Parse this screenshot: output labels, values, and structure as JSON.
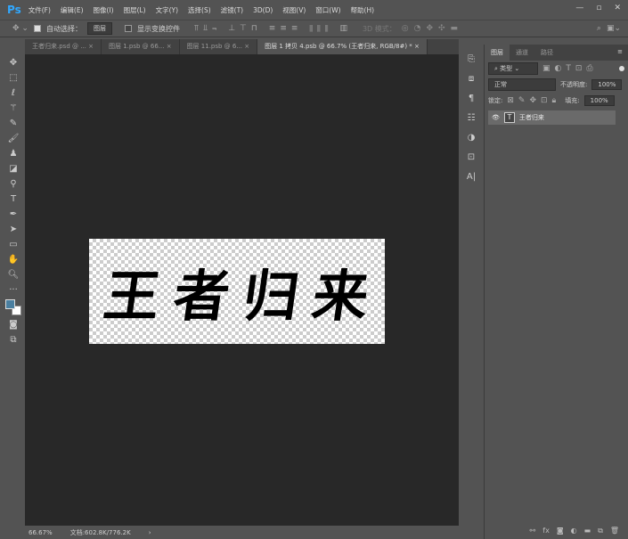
{
  "app": {
    "logo": "Ps"
  },
  "menu": [
    "文件(F)",
    "编辑(E)",
    "图像(I)",
    "图层(L)",
    "文字(Y)",
    "选择(S)",
    "滤镜(T)",
    "3D(D)",
    "视图(V)",
    "窗口(W)",
    "帮助(H)"
  ],
  "window_controls": {
    "minimize": "—",
    "restore": "▫",
    "close": "✕"
  },
  "options": {
    "auto_select_label": "自动选择：",
    "auto_select_checked": true,
    "auto_select_target": "图层",
    "show_transform_label": "显示变换控件",
    "show_transform_checked": false,
    "mode_3d": "3D 模式："
  },
  "tabs": [
    "王者归来.psd @ ...",
    "图层 1.psb @ 66...",
    "图层 11.psb @ 6...",
    "图层 1 拷贝 4.psb @ 66.7% (王者归来, RGB/8#) *"
  ],
  "active_tab": 3,
  "canvas": {
    "text_chars": [
      "王",
      "者",
      "归",
      "来"
    ]
  },
  "status": {
    "zoom": "66.67%",
    "doc_size": "文档:602.8K/776.2K"
  },
  "layers_panel": {
    "tabs": [
      "图层",
      "通道",
      "路径"
    ],
    "filter_kind": "类型",
    "blend_mode": "正常",
    "opacity_label": "不透明度:",
    "opacity": "100%",
    "lock_label": "锁定:",
    "fill_label": "填充:",
    "fill": "100%",
    "layers": [
      {
        "name": "王者归来",
        "type": "text",
        "visible": true
      }
    ]
  },
  "colors": {
    "foreground": "#4a7fa0",
    "background": "#ffffff",
    "accent": "#31a8ff"
  }
}
